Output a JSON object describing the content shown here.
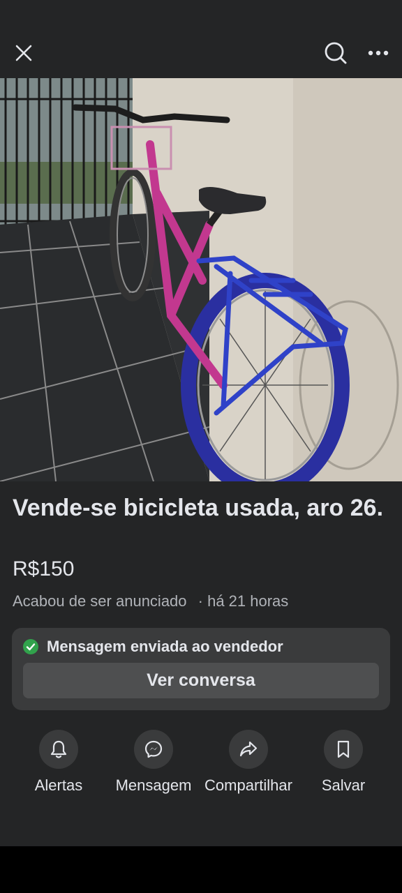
{
  "header": {
    "close_icon": "close-icon",
    "search_icon": "search-icon",
    "more_icon": "more-horizontal-icon"
  },
  "gallery": {
    "image_alt": "bicicleta",
    "total_images": 7,
    "active_index": 1
  },
  "listing": {
    "title": "Vende-se bicicleta usada, aro 26.",
    "price": "R$150",
    "listed_text": "Acabou de ser anunciado",
    "time_text": "· há 21 horas"
  },
  "message_card": {
    "status_text": "Mensagem enviada ao vendedor",
    "button_label": "Ver conversa",
    "status_color": "#31a24c"
  },
  "actions": [
    {
      "label": "Alertas",
      "icon": "bell-icon"
    },
    {
      "label": "Mensagem",
      "icon": "messenger-icon"
    },
    {
      "label": "Compartilhar",
      "icon": "share-icon"
    },
    {
      "label": "Salvar",
      "icon": "bookmark-icon"
    }
  ]
}
